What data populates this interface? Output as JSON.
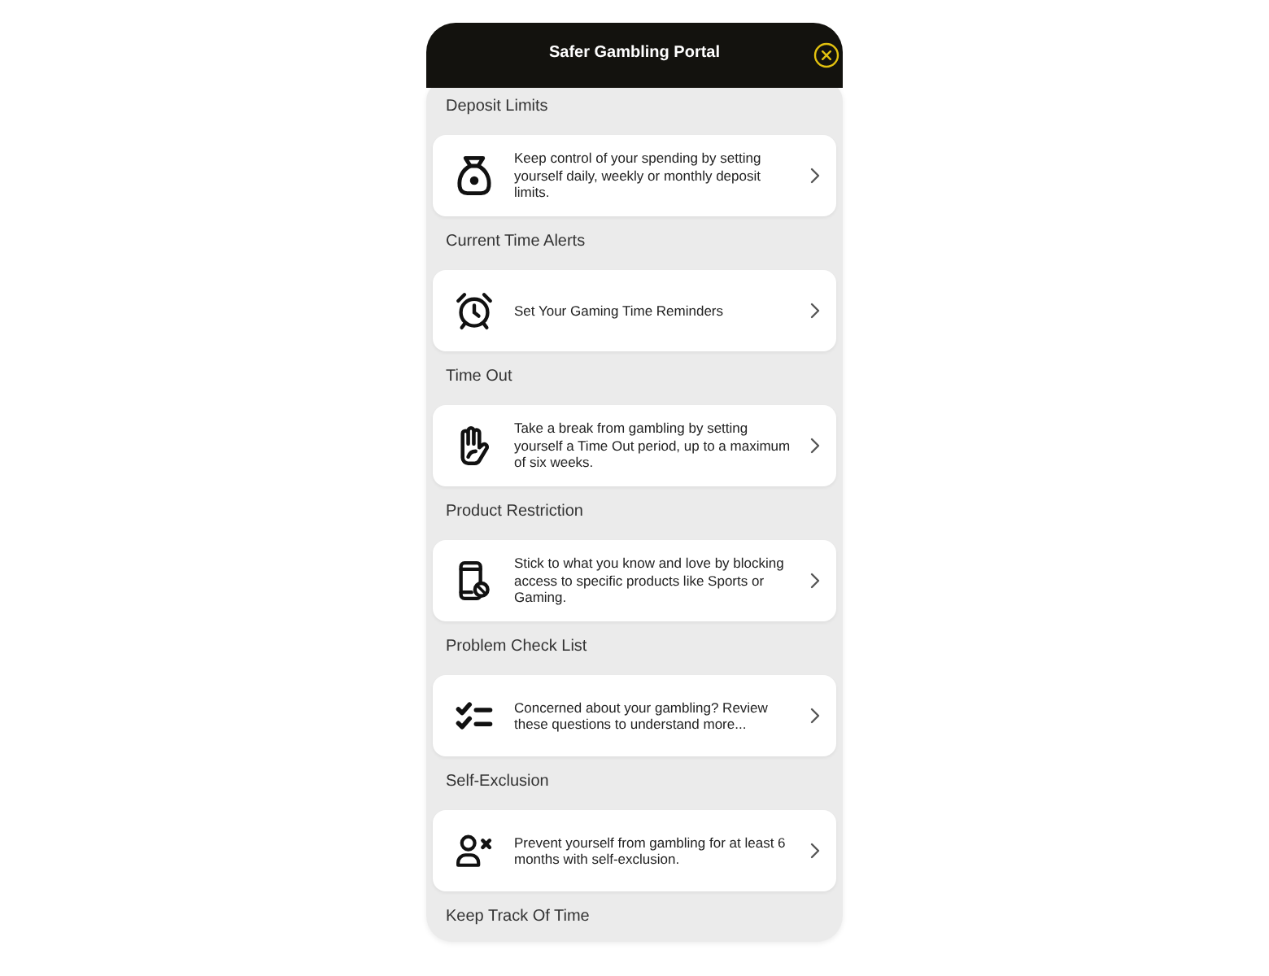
{
  "window": {
    "title": "Safer Gambling Portal"
  },
  "sections": [
    {
      "heading": "Deposit Limits",
      "card": {
        "kind": "pot",
        "text": "Keep control of your spending by setting yourself daily, weekly or monthly deposit limits."
      }
    },
    {
      "heading": "Current Time Alerts",
      "card": {
        "kind": "alarm",
        "text": "Set Your Gaming Time Reminders"
      }
    },
    {
      "heading": "Time Out",
      "card": {
        "kind": "hand",
        "text": "Take a break from gambling by setting yourself a Time Out period, up to a maximum of six weeks."
      }
    },
    {
      "heading": "Product Restriction",
      "card": {
        "kind": "phone",
        "text": "Stick to what you know and love by blocking access to specific products like Sports or Gaming."
      }
    },
    {
      "heading": "Problem Check List",
      "card": {
        "kind": "checklist",
        "text": "Concerned about your gambling? Review these questions to understand more..."
      }
    },
    {
      "heading": "Self-Exclusion",
      "card": {
        "kind": "person",
        "text": "Prevent yourself from gambling for at least 6 months with self-exclusion."
      }
    },
    {
      "heading": "Keep Track Of Time"
    }
  ]
}
